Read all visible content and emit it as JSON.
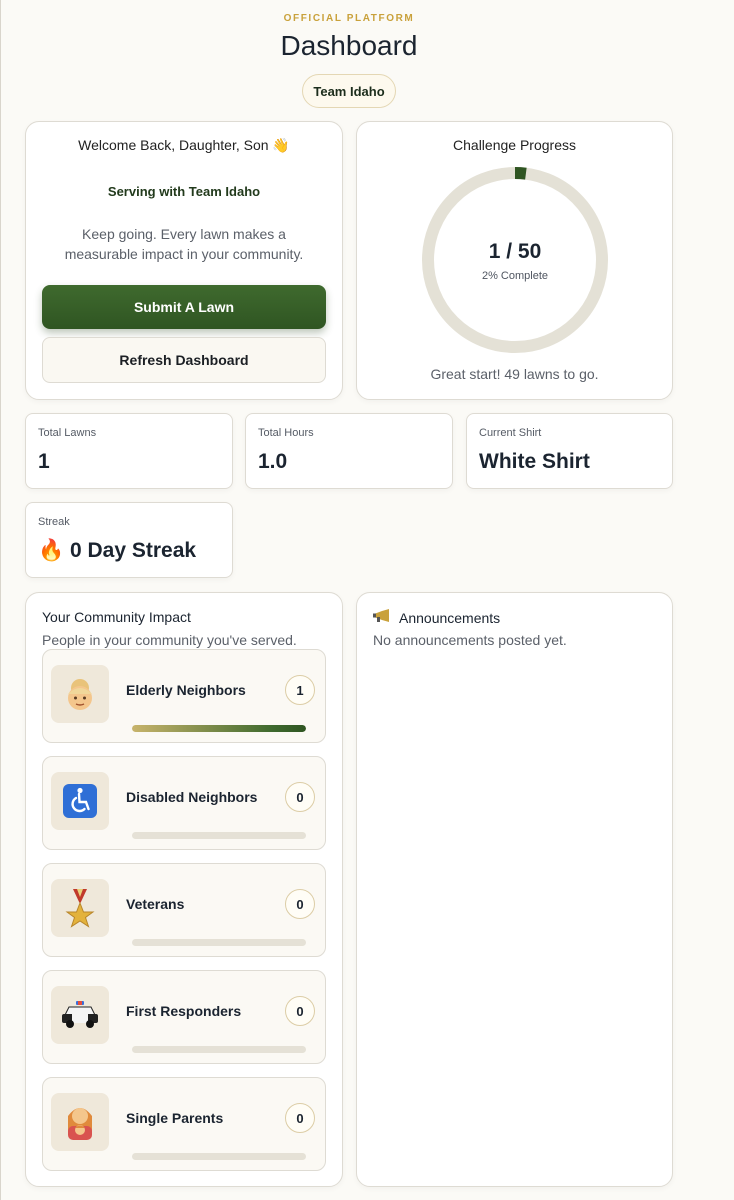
{
  "header": {
    "eyebrow": "OFFICIAL PLATFORM",
    "title": "Dashboard",
    "team_badge": "Team Idaho"
  },
  "welcome": {
    "greeting": "Welcome Back, Daughter, Son 👋",
    "serving": "Serving with Team Idaho",
    "message": "Keep going. Every lawn makes a measurable impact in your community.",
    "submit_label": "Submit A Lawn",
    "refresh_label": "Refresh Dashboard"
  },
  "progress": {
    "title": "Challenge Progress",
    "count": "1 / 50",
    "percent_text": "2% Complete",
    "fraction": 0.02,
    "footer": "Great start! 49 lawns to go."
  },
  "stats": {
    "lawns": {
      "label": "Total Lawns",
      "value": "1"
    },
    "hours": {
      "label": "Total Hours",
      "value": "1.0"
    },
    "shirt": {
      "label": "Current Shirt",
      "value": "White Shirt"
    },
    "streak": {
      "label": "Streak",
      "value": "🔥 0 Day Streak"
    }
  },
  "impact": {
    "title": "Your Community Impact",
    "subtitle": "People in your community you've served.",
    "items": [
      {
        "label": "Elderly Neighbors",
        "count": "1",
        "emoji": "👵",
        "icon": "elderly-icon",
        "fill": 1.0
      },
      {
        "label": "Disabled Neighbors",
        "count": "0",
        "emoji": "♿",
        "icon": "wheelchair-icon",
        "fill": 0
      },
      {
        "label": "Veterans",
        "count": "0",
        "emoji": "🎖️",
        "icon": "medal-icon",
        "fill": 0
      },
      {
        "label": "First Responders",
        "count": "0",
        "emoji": "🚓",
        "icon": "police-car-icon",
        "fill": 0
      },
      {
        "label": "Single Parents",
        "count": "0",
        "emoji": "👩‍👧",
        "icon": "parent-child-icon",
        "fill": 0
      }
    ]
  },
  "announcements": {
    "title": "Announcements",
    "icon": "megaphone-icon",
    "empty": "No announcements posted yet."
  },
  "colors": {
    "accent_green": "#2f5522",
    "gold": "#c9a13b",
    "ring_track": "#e4e1d6"
  }
}
